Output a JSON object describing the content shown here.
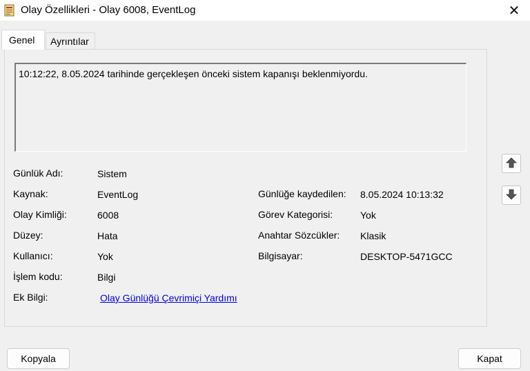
{
  "window": {
    "title": "Olay Özellikleri - Olay 6008, EventLog",
    "icon": "event-properties-icon",
    "close_glyph": "✕"
  },
  "tabs": [
    {
      "label": "Genel",
      "active": true
    },
    {
      "label": "Ayrıntılar",
      "active": false
    }
  ],
  "description": "10:12:22, 8.05.2024 tarihinde gerçekleşen önceki sistem kapanışı beklenmiyordu.",
  "fields": {
    "log_name": {
      "label": "Günlük Adı:",
      "value": "Sistem"
    },
    "source": {
      "label": "Kaynak:",
      "value": "EventLog"
    },
    "event_id": {
      "label": "Olay Kimliği:",
      "value": "6008"
    },
    "level": {
      "label": "Düzey:",
      "value": "Hata"
    },
    "user": {
      "label": "Kullanıcı:",
      "value": "Yok"
    },
    "opcode": {
      "label": "İşlem kodu:",
      "value": "Bilgi"
    },
    "more_info": {
      "label": "Ek Bilgi:",
      "value": "Olay Günlüğü Çevrimiçi Yardımı"
    },
    "logged": {
      "label": "Günlüğe kaydedilen:",
      "value": "8.05.2024 10:13:32"
    },
    "task_category": {
      "label": "Görev Kategorisi:",
      "value": "Yok"
    },
    "keywords": {
      "label": "Anahtar Sözcükler:",
      "value": "Klasik"
    },
    "computer": {
      "label": "Bilgisayar:",
      "value": "DESKTOP-5471GCC"
    }
  },
  "nav": {
    "up_icon": "arrow-up-icon",
    "down_icon": "arrow-down-icon"
  },
  "buttons": {
    "copy": "Kopyala",
    "close": "Kapat"
  }
}
